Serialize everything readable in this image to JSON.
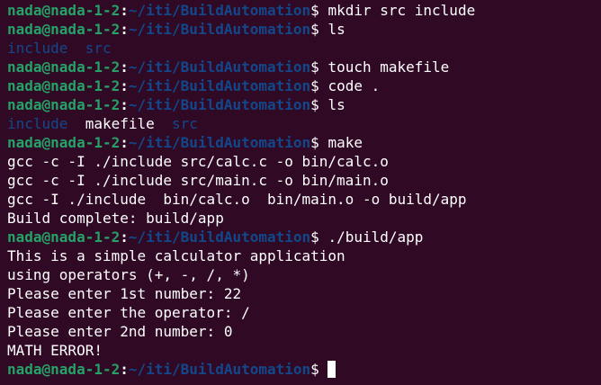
{
  "colors": {
    "background": "#300a24",
    "user_host": "#26a269",
    "path": "#12488b",
    "directory": "#12488b",
    "text": "#ffffff"
  },
  "prompt": {
    "user_host": "nada@nada-1-2",
    "separator": ":",
    "path": "~/iti/BuildAutomation",
    "symbol": "$"
  },
  "lines": [
    {
      "kind": "prompt",
      "command": " mkdir src include"
    },
    {
      "kind": "prompt",
      "command": " ls"
    },
    {
      "kind": "dirs",
      "entries": [
        {
          "text": "include",
          "type": "dir"
        },
        {
          "text": "  ",
          "type": "space"
        },
        {
          "text": "src",
          "type": "dir"
        }
      ]
    },
    {
      "kind": "prompt",
      "command": " touch makefile"
    },
    {
      "kind": "prompt",
      "command": " code ."
    },
    {
      "kind": "prompt",
      "command": " ls"
    },
    {
      "kind": "dirs",
      "entries": [
        {
          "text": "include",
          "type": "dir"
        },
        {
          "text": "  makefile  ",
          "type": "file"
        },
        {
          "text": "src",
          "type": "dir"
        }
      ]
    },
    {
      "kind": "prompt",
      "command": " make"
    },
    {
      "kind": "output",
      "text": "gcc -c -I ./include src/calc.c -o bin/calc.o"
    },
    {
      "kind": "output",
      "text": "gcc -c -I ./include src/main.c -o bin/main.o"
    },
    {
      "kind": "output",
      "text": "gcc -I ./include  bin/calc.o  bin/main.o -o build/app"
    },
    {
      "kind": "output",
      "text": "Build complete: build/app"
    },
    {
      "kind": "prompt",
      "command": " ./build/app"
    },
    {
      "kind": "output",
      "text": "This is a simple calculator application"
    },
    {
      "kind": "output",
      "text": "using operators (+, -, /, *)"
    },
    {
      "kind": "output",
      "text": "Please enter 1st number: 22"
    },
    {
      "kind": "output",
      "text": "Please enter the operator: /"
    },
    {
      "kind": "output",
      "text": "Please enter 2nd number: 0"
    },
    {
      "kind": "output",
      "text": "MATH ERROR!"
    },
    {
      "kind": "prompt",
      "command": " ",
      "cursor": true
    }
  ]
}
